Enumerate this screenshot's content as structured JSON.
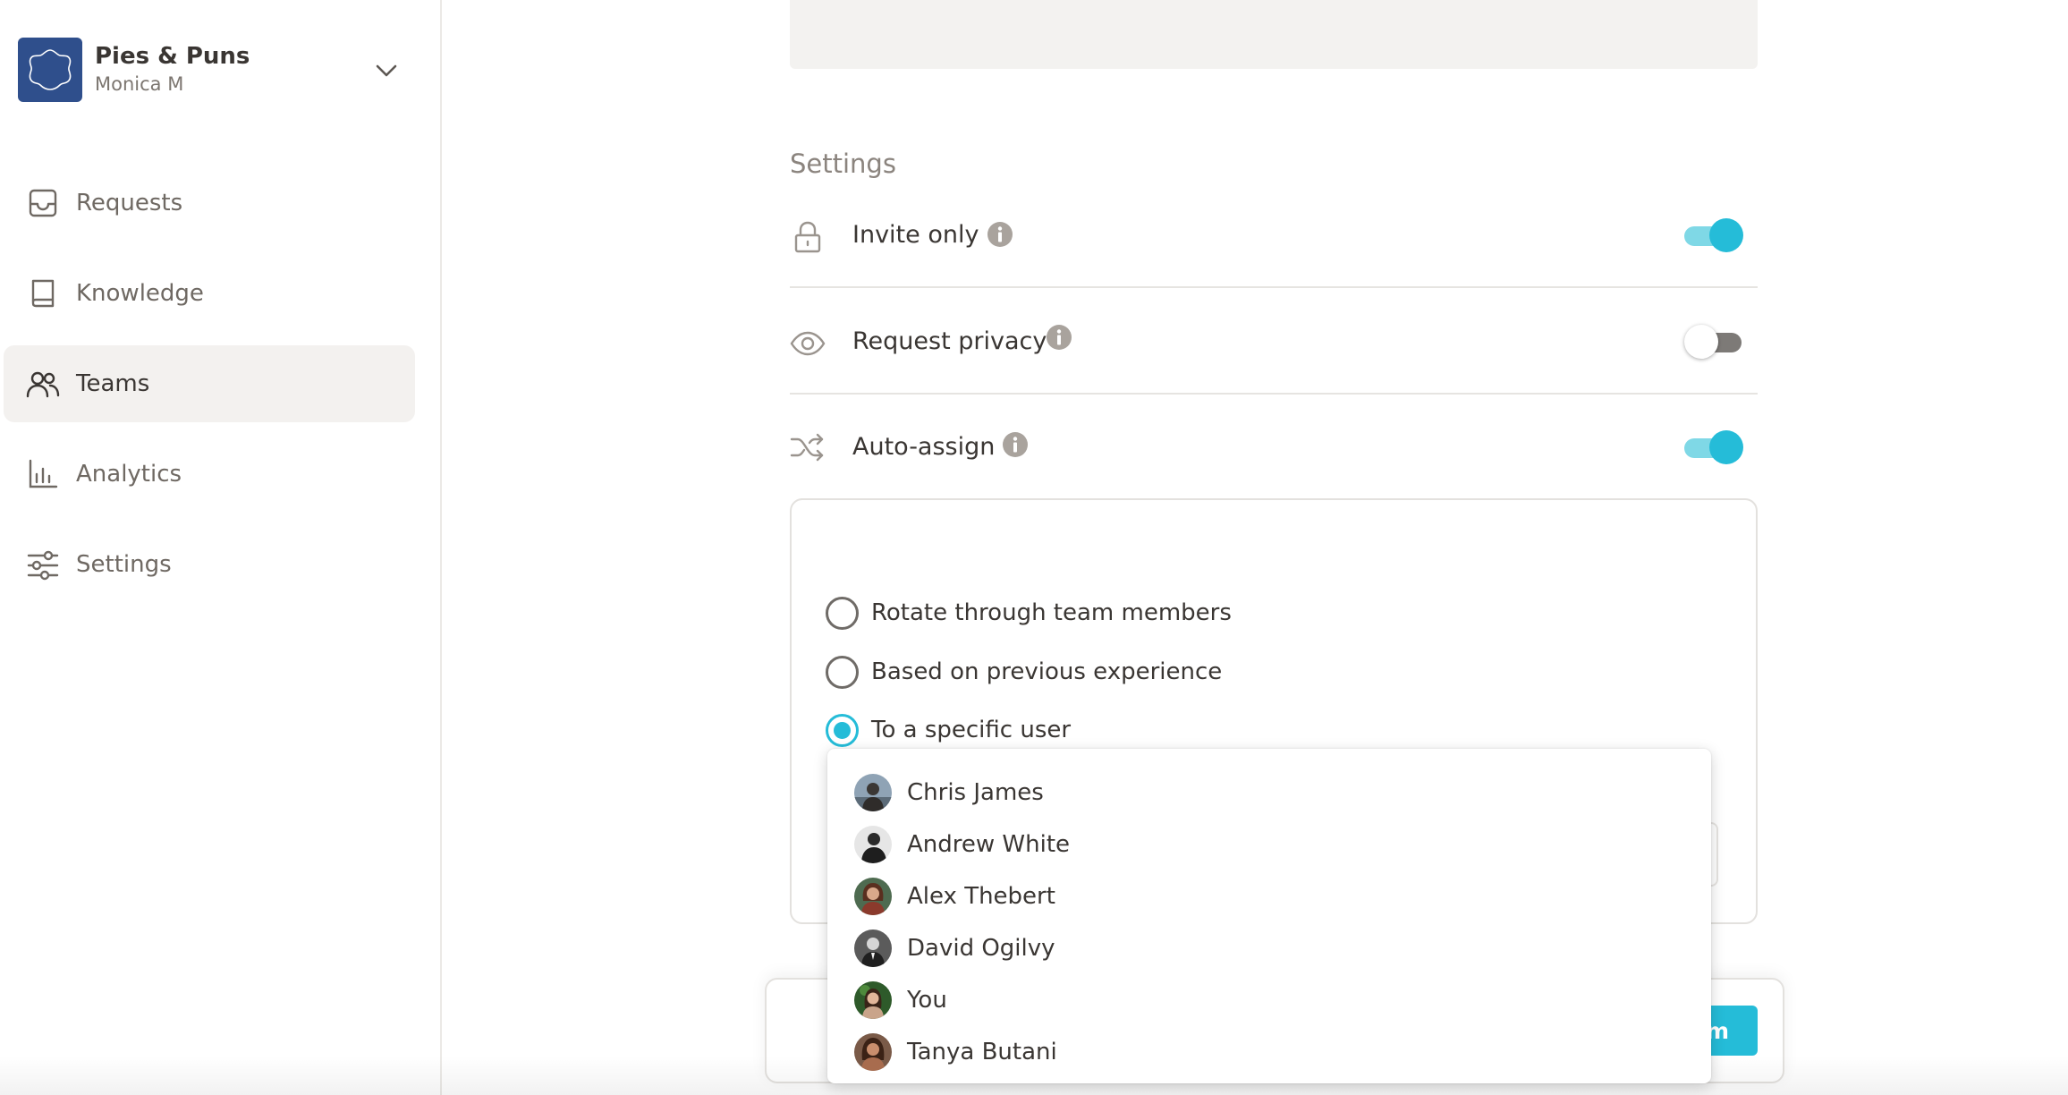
{
  "workspace": {
    "name": "Pies & Puns",
    "user": "Monica M",
    "logo_color": "#2f4f8c"
  },
  "sidebar": {
    "items": [
      {
        "label": "Requests",
        "icon": "inbox-icon",
        "active": false
      },
      {
        "label": "Knowledge",
        "icon": "book-icon",
        "active": false
      },
      {
        "label": "Teams",
        "icon": "users-icon",
        "active": true
      },
      {
        "label": "Analytics",
        "icon": "bar-chart-icon",
        "active": false
      },
      {
        "label": "Settings",
        "icon": "sliders-icon",
        "active": false
      }
    ]
  },
  "settings": {
    "title": "Settings",
    "invite_only": {
      "label": "Invite only",
      "icon": "lock-icon",
      "enabled": true
    },
    "request_privacy": {
      "label": "Request privacy",
      "icon": "eye-icon",
      "enabled": false
    },
    "auto_assign": {
      "label": "Auto-assign",
      "icon": "shuffle-icon",
      "enabled": true
    }
  },
  "assign_options": {
    "options": [
      {
        "label": "Rotate through team members",
        "selected": false
      },
      {
        "label": "Based on previous experience",
        "selected": false
      },
      {
        "label": "To a specific user",
        "selected": true
      }
    ]
  },
  "user_dropdown": {
    "users": [
      {
        "name": "Chris James"
      },
      {
        "name": "Andrew White"
      },
      {
        "name": "Alex Thebert"
      },
      {
        "name": "David Ogilvy"
      },
      {
        "name": "You"
      },
      {
        "name": "Tanya Butani"
      }
    ]
  },
  "footer": {
    "create_label_visible": "m"
  },
  "colors": {
    "accent": "#25bcd8",
    "toggle_track_on": "#7fd8e6",
    "active_nav_bg": "#f3f1ef",
    "text": "#3a3633"
  }
}
